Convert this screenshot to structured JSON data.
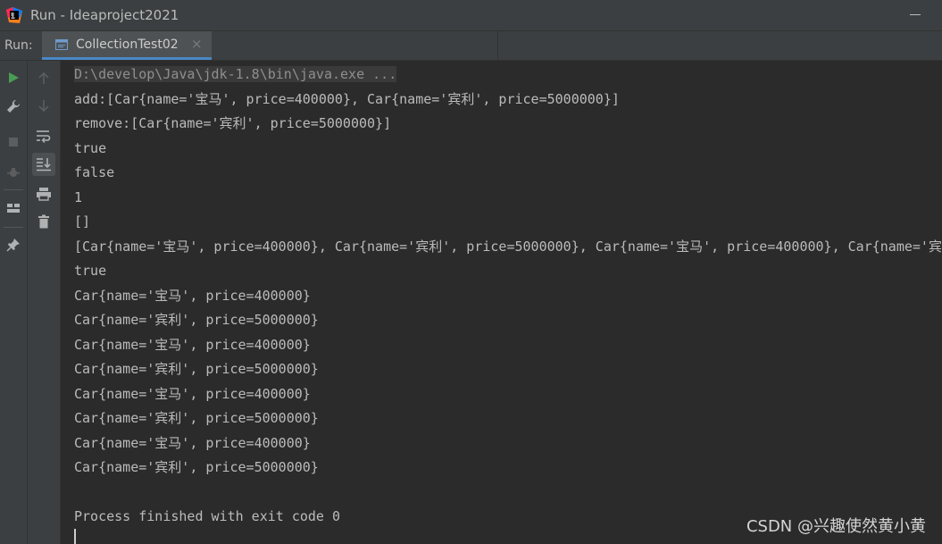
{
  "window": {
    "title": "Run - Ideaproject2021"
  },
  "run": {
    "label": "Run:",
    "tab_label": "CollectionTest02",
    "tab_close": "×"
  },
  "console": {
    "lines": [
      "D:\\develop\\Java\\jdk-1.8\\bin\\java.exe ...",
      "add:[Car{name='宝马', price=400000}, Car{name='宾利', price=5000000}]",
      "remove:[Car{name='宾利', price=5000000}]",
      "true",
      "false",
      "1",
      "[]",
      "[Car{name='宝马', price=400000}, Car{name='宾利', price=5000000}, Car{name='宝马', price=400000}, Car{name='宾",
      "true",
      "Car{name='宝马', price=400000}",
      "Car{name='宾利', price=5000000}",
      "Car{name='宝马', price=400000}",
      "Car{name='宾利', price=5000000}",
      "Car{name='宝马', price=400000}",
      "Car{name='宾利', price=5000000}",
      "Car{name='宝马', price=400000}",
      "Car{name='宾利', price=5000000}",
      "",
      "Process finished with exit code 0"
    ]
  },
  "watermark": "CSDN @兴趣使然黄小黄",
  "icons": {
    "run": "run-icon",
    "wrench": "wrench-icon",
    "stop": "stop-icon",
    "debug": "debug-icon",
    "layout": "layout-icon",
    "pin": "pin-icon",
    "up": "arrow-up-icon",
    "down": "arrow-down-icon",
    "wrap": "soft-wrap-icon",
    "scroll": "scroll-to-end-icon",
    "print": "print-icon",
    "trash": "trash-icon"
  },
  "colors": {
    "background": "#2b2b2b",
    "panel": "#3c3f41",
    "text": "#bbbbbb",
    "accent": "#4a88c7",
    "run_green": "#499c54"
  }
}
